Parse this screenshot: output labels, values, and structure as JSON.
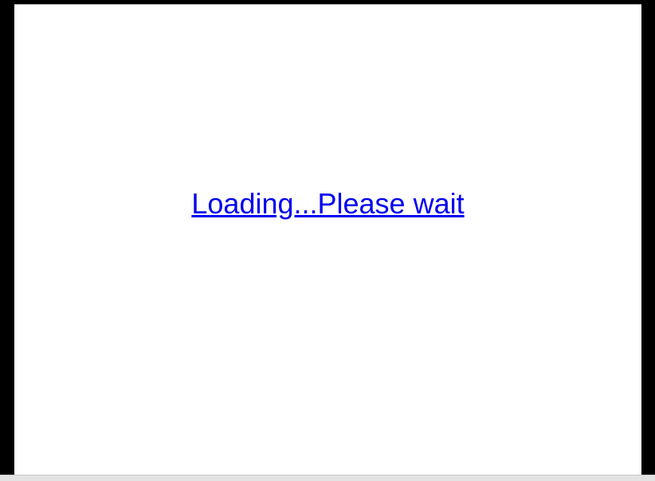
{
  "page": {
    "loading_text": "Loading...Please wait"
  },
  "colors": {
    "frame": "#000000",
    "page_background": "#ffffff",
    "link": "#0000ee",
    "bottom_bar": "#e3e3e3"
  }
}
